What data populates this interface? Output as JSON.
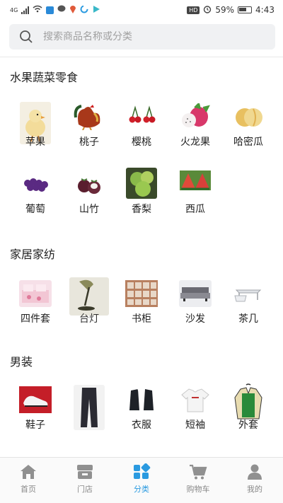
{
  "status": {
    "network": "4G",
    "battery_percent": "59%",
    "time": "4:43",
    "hd_badge": "HD"
  },
  "search": {
    "placeholder": "搜索商品名称或分类"
  },
  "sections": [
    {
      "title": "水果蔬菜零食",
      "items": [
        {
          "label": "苹果",
          "icon": "chick-image",
          "color": "#e8d9b0"
        },
        {
          "label": "桃子",
          "icon": "rooster-image",
          "color": "#b03a1a"
        },
        {
          "label": "樱桃",
          "icon": "cherry-image",
          "color": "#c8202a"
        },
        {
          "label": "火龙果",
          "icon": "dragonfruit-image",
          "color": "#d03a6a"
        },
        {
          "label": "哈密瓜",
          "icon": "melon-image",
          "color": "#e8b850"
        },
        {
          "label": "葡萄",
          "icon": "grape-image",
          "color": "#5a2a7a"
        },
        {
          "label": "山竹",
          "icon": "mangosteen-image",
          "color": "#6a2a3a"
        },
        {
          "label": "香梨",
          "icon": "pear-image",
          "color": "#7aaa3a"
        },
        {
          "label": "西瓜",
          "icon": "watermelon-image",
          "color": "#d0403a"
        }
      ]
    },
    {
      "title": "家居家纺",
      "items": [
        {
          "label": "四件套",
          "icon": "bedding-image",
          "color": "#e9b9c9"
        },
        {
          "label": "台灯",
          "icon": "lamp-image",
          "color": "#8a8a6a"
        },
        {
          "label": "书柜",
          "icon": "bookcase-image",
          "color": "#a06a4a"
        },
        {
          "label": "沙发",
          "icon": "sofa-image",
          "color": "#9a9aa0"
        },
        {
          "label": "茶几",
          "icon": "tea-table-image",
          "color": "#cfd3d8"
        }
      ]
    },
    {
      "title": "男装",
      "items": [
        {
          "label": "鞋子",
          "icon": "shoe-image",
          "color": "#c0202a"
        },
        {
          "label": "裤子",
          "icon": "pants-image",
          "color": "#2a2a30"
        },
        {
          "label": "衣服",
          "icon": "suit-image",
          "color": "#20242a"
        },
        {
          "label": "短袖",
          "icon": "tshirt-image",
          "color": "#e8e8e8"
        },
        {
          "label": "外套",
          "icon": "jacket-image",
          "color": "#2a8a3a"
        }
      ]
    }
  ],
  "tabs": [
    {
      "label": "首页",
      "icon": "home-icon",
      "active": false
    },
    {
      "label": "门店",
      "icon": "store-icon",
      "active": false
    },
    {
      "label": "分类",
      "icon": "category-icon",
      "active": true
    },
    {
      "label": "购物车",
      "icon": "cart-icon",
      "active": false
    },
    {
      "label": "我的",
      "icon": "profile-icon",
      "active": false
    }
  ],
  "colors": {
    "accent": "#2a9ae0",
    "tab_inactive": "#888888"
  }
}
